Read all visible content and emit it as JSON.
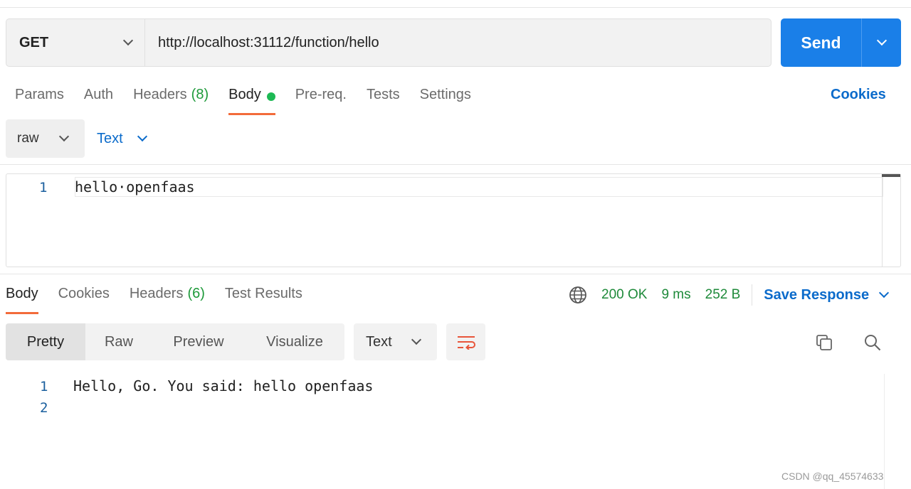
{
  "request": {
    "method": "GET",
    "url": "http://localhost:31112/function/hello",
    "send_label": "Send"
  },
  "request_tabs": [
    {
      "label": "Params"
    },
    {
      "label": "Auth"
    },
    {
      "label": "Headers",
      "count": "(8)"
    },
    {
      "label": "Body"
    },
    {
      "label": "Pre-req."
    },
    {
      "label": "Tests"
    },
    {
      "label": "Settings"
    }
  ],
  "cookies_link": "Cookies",
  "body_mode": {
    "mode": "raw",
    "format": "Text"
  },
  "request_body": {
    "line_number": "1",
    "code": "hello·openfaas"
  },
  "response_tabs": [
    {
      "label": "Body"
    },
    {
      "label": "Cookies"
    },
    {
      "label": "Headers",
      "count": "(6)"
    },
    {
      "label": "Test Results"
    }
  ],
  "response_status": {
    "status": "200 OK",
    "time": "9 ms",
    "size": "252 B",
    "save_label": "Save Response"
  },
  "response_views": [
    "Pretty",
    "Raw",
    "Preview",
    "Visualize"
  ],
  "response_format": "Text",
  "response_body": {
    "lines": [
      "1",
      "2"
    ],
    "code": "Hello, Go. You said: hello openfaas"
  },
  "watermark": "CSDN @qq_45574633",
  "colors": {
    "accent": "#1a7fe8",
    "link": "#0b6bcb",
    "active_tab": "#f26b3a",
    "success": "#1e8a3a"
  }
}
